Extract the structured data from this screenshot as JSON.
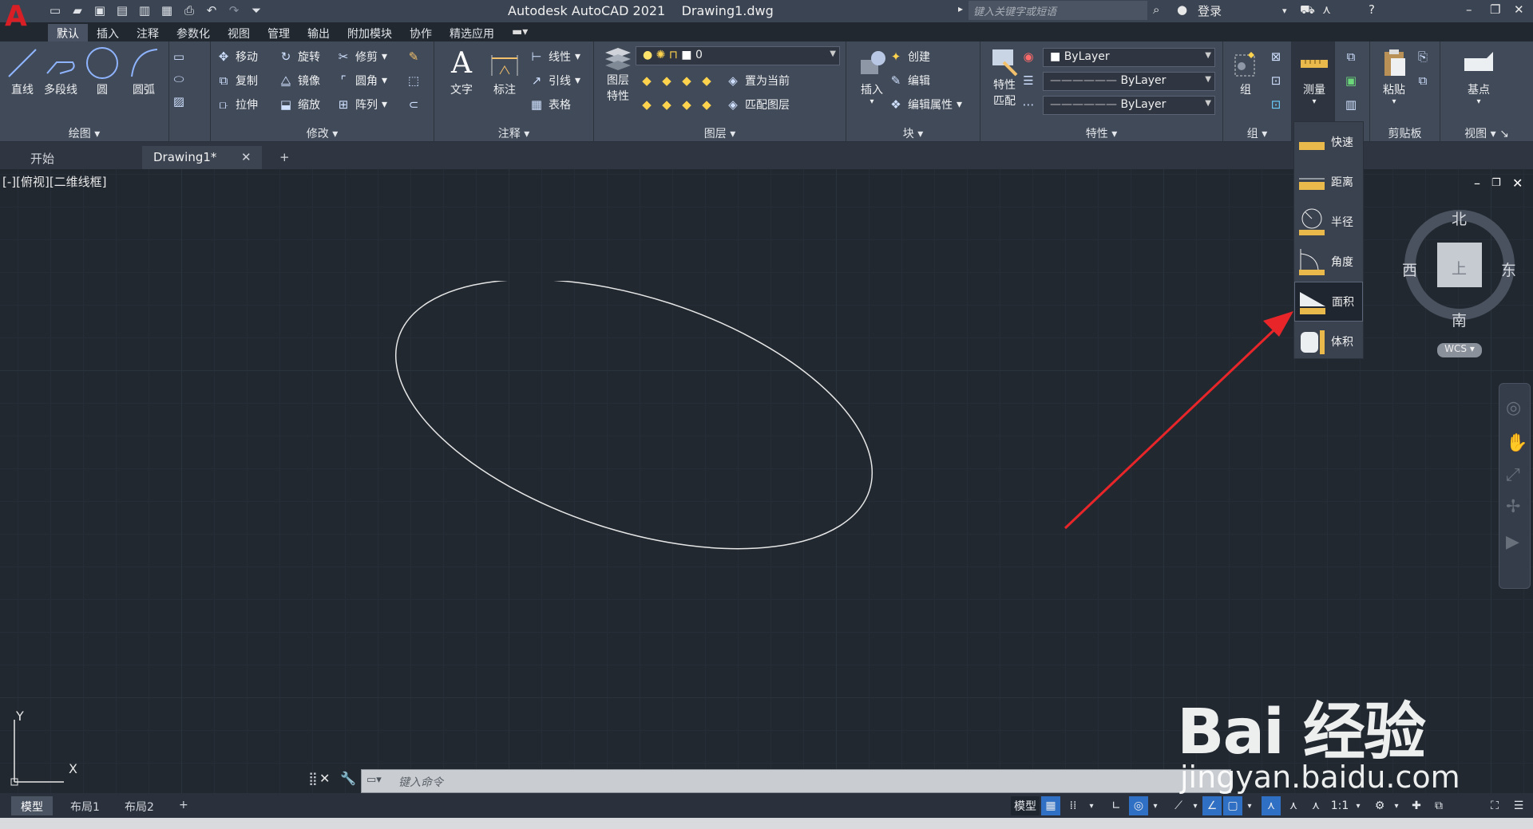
{
  "app": {
    "logo_letter": "A",
    "title": "Autodesk AutoCAD 2021    Drawing1.dwg",
    "search_placeholder": "键入关键字或短语",
    "login": "登录"
  },
  "ribbon_tabs": [
    "默认",
    "插入",
    "注释",
    "参数化",
    "视图",
    "管理",
    "输出",
    "附加模块",
    "协作",
    "精选应用"
  ],
  "panels": {
    "draw": {
      "title": "绘图",
      "line": "直线",
      "polyline": "多段线",
      "circle": "圆",
      "arc": "圆弧"
    },
    "modify": {
      "title": "修改",
      "move": "移动",
      "rotate": "旋转",
      "trim": "修剪",
      "copy": "复制",
      "mirror": "镜像",
      "fillet": "圆角",
      "stretch": "拉伸",
      "scale": "缩放",
      "array": "阵列"
    },
    "annotation": {
      "title": "注释",
      "text": "文字",
      "dimension": "标注",
      "linear": "线性",
      "leader": "引线",
      "table": "表格"
    },
    "layers": {
      "title": "图层",
      "layer_props_1": "图层",
      "layer_props_2": "特性",
      "current_layer": "0",
      "set_current": "置为当前",
      "match_layer": "匹配图层"
    },
    "block": {
      "title": "块",
      "insert": "插入",
      "create": "创建",
      "edit": "编辑",
      "edit_attr": "编辑属性"
    },
    "properties": {
      "title": "特性",
      "match_1": "特性",
      "match_2": "匹配",
      "color": "ByLayer",
      "linetype": "ByLayer",
      "lineweight": "ByLayer"
    },
    "group": {
      "title": "组",
      "group": "组"
    },
    "measure": {
      "label": "测量"
    },
    "clipboard": {
      "title": "剪贴板",
      "paste": "粘贴"
    },
    "view": {
      "title": "视图",
      "base": "基点"
    }
  },
  "file_tabs": {
    "start": "开始",
    "drawing": "Drawing1*",
    "add": "+"
  },
  "viewport": {
    "label": "[-][俯视][二维线框]"
  },
  "measure_menu": [
    {
      "label": "快速",
      "icon": "quick-measure-icon"
    },
    {
      "label": "距离",
      "icon": "distance-icon"
    },
    {
      "label": "半径",
      "icon": "radius-icon"
    },
    {
      "label": "角度",
      "icon": "angle-icon"
    },
    {
      "label": "面积",
      "icon": "area-icon"
    },
    {
      "label": "体积",
      "icon": "volume-icon"
    }
  ],
  "viewcube": {
    "north": "北",
    "south": "南",
    "east": "东",
    "west": "西",
    "top": "上",
    "wcs": "WCS"
  },
  "ucs": {
    "x": "X",
    "y": "Y"
  },
  "command_line": {
    "placeholder": "键入命令"
  },
  "layout_tabs": [
    "模型",
    "布局1",
    "布局2"
  ],
  "status": {
    "model": "模型",
    "scale": "1:1"
  },
  "watermark": {
    "brand": "Bai  经验",
    "url": "jingyan.baidu.com"
  }
}
